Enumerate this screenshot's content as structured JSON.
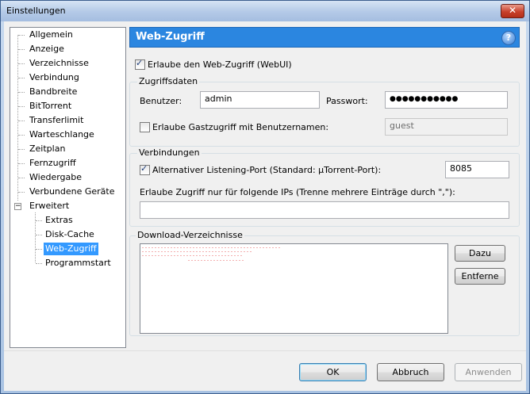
{
  "window": {
    "title": "Einstellungen",
    "close_glyph": "✕"
  },
  "sidebar": {
    "items": [
      {
        "label": "Allgemein"
      },
      {
        "label": "Anzeige"
      },
      {
        "label": "Verzeichnisse"
      },
      {
        "label": "Verbindung"
      },
      {
        "label": "Bandbreite"
      },
      {
        "label": "BitTorrent"
      },
      {
        "label": "Transferlimit"
      },
      {
        "label": "Warteschlange"
      },
      {
        "label": "Zeitplan"
      },
      {
        "label": "Fernzugriff"
      },
      {
        "label": "Wiedergabe"
      },
      {
        "label": "Verbundene Geräte"
      },
      {
        "label": "Erweitert"
      }
    ],
    "expander_glyph": "−",
    "children": [
      {
        "label": "Extras"
      },
      {
        "label": "Disk-Cache"
      },
      {
        "label": "Web-Zugriff"
      },
      {
        "label": "Programmstart"
      }
    ],
    "selected": "Web-Zugriff"
  },
  "header": {
    "title": "Web-Zugriff",
    "help_glyph": "?"
  },
  "webui": {
    "enable_label": "Erlaube den Web-Zugriff (WebUI)",
    "enabled": true
  },
  "access": {
    "caption": "Zugriffsdaten",
    "user_label": "Benutzer:",
    "user_value": "admin",
    "password_label": "Passwort:",
    "password_value": "●●●●●●●●●●●",
    "guest_label": "Erlaube Gastzugriff mit Benutzernamen:",
    "guest_enabled": false,
    "guest_value": "guest"
  },
  "connections": {
    "caption": "Verbindungen",
    "alt_port_label": "Alternativer Listening-Port (Standard: µTorrent-Port):",
    "alt_port_enabled": true,
    "alt_port_value": "8085",
    "ip_label": "Erlaube Zugriff nur für folgende IPs (Trenne mehrere Einträge durch \",\"):",
    "ip_value": ""
  },
  "downloads": {
    "caption": "Download-Verzeichnisse",
    "add_label": "Dazu",
    "remove_label": "Entferne"
  },
  "footer": {
    "ok_label": "OK",
    "cancel_label": "Abbruch",
    "apply_label": "Anwenden"
  },
  "colors": {
    "selection": "#3399ff",
    "header": "#2b86e0"
  }
}
